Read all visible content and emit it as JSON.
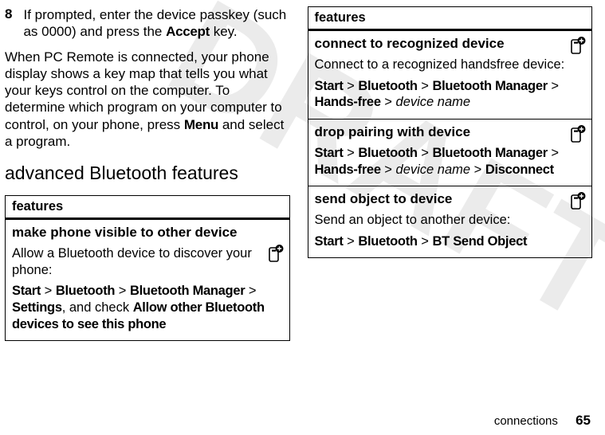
{
  "left": {
    "step": {
      "num": "8",
      "text_before": "If prompted, enter the device passkey (such as 0000) and press the ",
      "accept": "Accept",
      "text_after": " key."
    },
    "para_parts": {
      "a": "When PC Remote is connected, your phone display shows a key map that tells you what your keys control on the computer. To determine which program on your computer to control, on your phone, press ",
      "menu": "Menu",
      "b": " and select a program."
    },
    "section_title": "advanced Bluetooth features",
    "features_label": "features",
    "feat1": {
      "title": "make phone visible to other device",
      "body": "Allow a Bluetooth device to discover your phone:",
      "path": {
        "start": "Start",
        "s1": " > ",
        "bt": "Bluetooth",
        "s2": " > ",
        "mgr": "Bluetooth Manager",
        "s3": " > ",
        "settings": "Settings",
        "tail": ", and check ",
        "allow": "Allow other Bluetooth devices to see this phone"
      }
    }
  },
  "right": {
    "features_label": "features",
    "feat2": {
      "title": "connect to recognized device",
      "body": "Connect to a recognized handsfree device:",
      "path": {
        "start": "Start",
        "s1": " > ",
        "bt": "Bluetooth",
        "s2": " > ",
        "mgr": "Bluetooth Manager",
        "s3": " > ",
        "hf": "Hands-free",
        "s4": " > ",
        "dn": "device name"
      }
    },
    "feat3": {
      "title": "drop pairing with device",
      "path": {
        "start": "Start",
        "s1": " > ",
        "bt": "Bluetooth",
        "s2": " > ",
        "mgr": "Bluetooth Manager",
        "s3": " > ",
        "hf": "Hands-free",
        "s4": " > ",
        "dn": "device name",
        "s5": " > ",
        "disc": "Disconnect"
      }
    },
    "feat4": {
      "title": "send object to device",
      "body": "Send an object to another device:",
      "path": {
        "start": "Start",
        "s1": " > ",
        "bt": "Bluetooth",
        "s2": " > ",
        "send": "BT Send Object"
      }
    }
  },
  "footer": {
    "section": "connections",
    "page": "65"
  }
}
